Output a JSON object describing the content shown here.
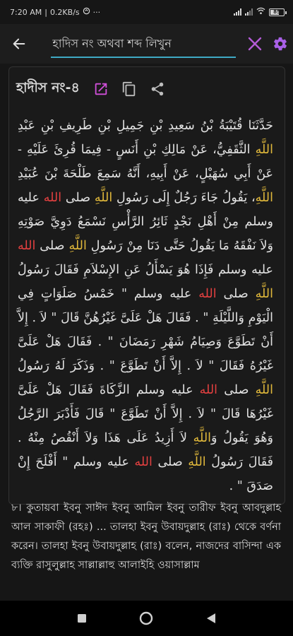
{
  "status_bar": {
    "time": "7:20 AM",
    "speed": "0.2KB/s",
    "more": "···",
    "battery": "85"
  },
  "search": {
    "placeholder": "হাদিস নং অথবা শব্দ লিখুন",
    "value": ""
  },
  "colors": {
    "accent": "#3fa9c5",
    "clear_icon": "#b45bd6",
    "gear_icon": "#a960e8",
    "share_icon": "#cf4fd8",
    "allah": "#e0b83b",
    "salla": "#e24040"
  },
  "card": {
    "hadith_label": "হাদীস নং-৪",
    "icons": [
      "open-external-icon",
      "copy-icon",
      "share-icon"
    ],
    "arabic_segments": [
      {
        "t": "حَدَّثَنَا قُتَيْبَةُ بْنُ سَعِيدِ بْنِ جَمِيلِ بْنِ طَرِيفِ بْنِ عَبْدِ "
      },
      {
        "t": "اللَّهِ",
        "c": "allah"
      },
      {
        "t": " الثَّقَفِيُّ، عَنْ مَالِكِ بْنِ أَنَسٍ - فِيمَا قُرِئَ عَلَيْهِ - عَنْ أَبِي سُهَيْلٍ، عَنْ أَبِيهِ، أَنَّهُ سَمِعَ طَلْحَةَ بْنَ عُبَيْدِ "
      },
      {
        "t": "اللَّهِ",
        "c": "allah"
      },
      {
        "t": "، يَقُولُ جَاءَ رَجُلٌ إِلَى رَسُولِ "
      },
      {
        "t": "اللَّهِ",
        "c": "allah"
      },
      {
        "t": " صلى "
      },
      {
        "t": "الله",
        "c": "red"
      },
      {
        "t": " عليه وسلم مِنْ أَهْلِ نَجْدٍ ثَائِرُ الرَّأْسِ نَسْمَعُ دَوِيَّ صَوْتِهِ وَلاَ نَفْقَهُ مَا يَقُولُ حَتَّى دَنَا مِنْ رَسُولِ "
      },
      {
        "t": "اللَّهِ",
        "c": "allah"
      },
      {
        "t": " صلى "
      },
      {
        "t": "الله",
        "c": "red"
      },
      {
        "t": " عليه وسلم فَإِذَا هُوَ يَسْأَلُ عَنِ الإِسْلاَمِ فَقَالَ رَسُولُ "
      },
      {
        "t": "اللَّهِ",
        "c": "allah"
      },
      {
        "t": " صلى "
      },
      {
        "t": "الله",
        "c": "red"
      },
      {
        "t": " عليه وسلم \" خَمْسُ صَلَوَاتٍ فِي الْيَوْمِ وَاللَّيْلَةِ \" . فَقَالَ هَلْ عَلَىَّ غَيْرُهُنَّ قَالَ \" لاَ . إِلاَّ أَنْ تَطَوَّعَ وَصِيَامُ شَهْرِ رَمَضَانَ \" . فَقَالَ هَلْ عَلَىَّ غَيْرُهُ فَقَالَ \" لاَ . إِلاَّ أَنْ تَطَوَّعَ \" . وَذَكَرَ لَهُ رَسُولُ "
      },
      {
        "t": "اللَّهِ",
        "c": "allah"
      },
      {
        "t": " صلى "
      },
      {
        "t": "الله",
        "c": "red"
      },
      {
        "t": " عليه وسلم الزَّكَاةَ فَقَالَ هَلْ عَلَىَّ غَيْرُهَا قَالَ \" لاَ . إِلاَّ أَنْ تَطَوَّعَ \" قَالَ فَأَدْبَرَ الرَّجُلُ وَهُوَ يَقُولُ وَ"
      },
      {
        "t": "اللَّهِ",
        "c": "allah"
      },
      {
        "t": " لاَ أَزِيدُ عَلَى هَذَا وَلاَ أَنْقُصُ مِنْهُ . فَقَالَ رَسُولُ "
      },
      {
        "t": "اللَّهِ",
        "c": "allah"
      },
      {
        "t": " صلى "
      },
      {
        "t": "الله",
        "c": "red"
      },
      {
        "t": " عليه وسلم \" أَفْلَحَ إِنْ صَدَقَ \" ."
      }
    ],
    "bangla": "৮। কুতায়বা ইবনু সাঈদ ইবনু আমিল ইবনু তারীফ ইবনু আবদুল্লাহ আল সাকাফী (রহঃ) ... তালহা ইবনু উবায়দুল্লাহ (রাঃ) থেকে বর্ণনা করেন। তালহা ইবনু উবায়দুল্লাহ (রাঃ) বলেন, নাজদের বাসিন্দা এক ব্যক্তি রাসুলুল্লাহ সাল্লাল্লাহু আলাইহি ওয়াসাল্লাম"
  },
  "navbar": [
    "recents-square-icon",
    "home-circle-icon",
    "back-triangle-icon"
  ]
}
